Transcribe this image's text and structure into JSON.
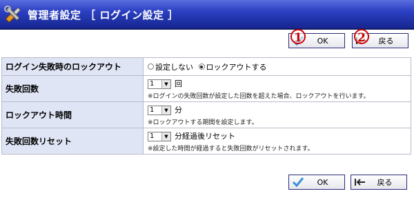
{
  "window": {
    "title": "管理者設定 ［ ログイン設定 ］",
    "icon": "tools-icon"
  },
  "toolbar_top": {
    "ok_label": "OK",
    "back_label": "戻る",
    "ok_badge": "1",
    "back_badge": "2"
  },
  "settings": {
    "lockout": {
      "label": "ログイン失敗時のロックアウト",
      "options": [
        "設定しない",
        "ロックアウトする"
      ],
      "selected": "ロックアウトする"
    },
    "fail_count": {
      "label": "失敗回数",
      "value": "1",
      "unit": "回",
      "note": "※ログインの失敗回数が設定した回数を超えた場合、ロックアウトを行います。"
    },
    "lockout_time": {
      "label": "ロックアウト時間",
      "value": "1",
      "unit": "分",
      "note": "※ロックアウトする期間を設定します。"
    },
    "reset": {
      "label": "失敗回数リセット",
      "value": "1",
      "unit": "分経過後リセット",
      "note": "※設定した時間が経過すると失敗回数がリセットされます。"
    }
  },
  "toolbar_bottom": {
    "ok_label": "OK",
    "back_label": "戻る"
  },
  "colors": {
    "title_bar": "#1e30a8",
    "label_cell": "#dfe5f5",
    "badge": "#cc0000",
    "check": "#3a8fd8"
  }
}
